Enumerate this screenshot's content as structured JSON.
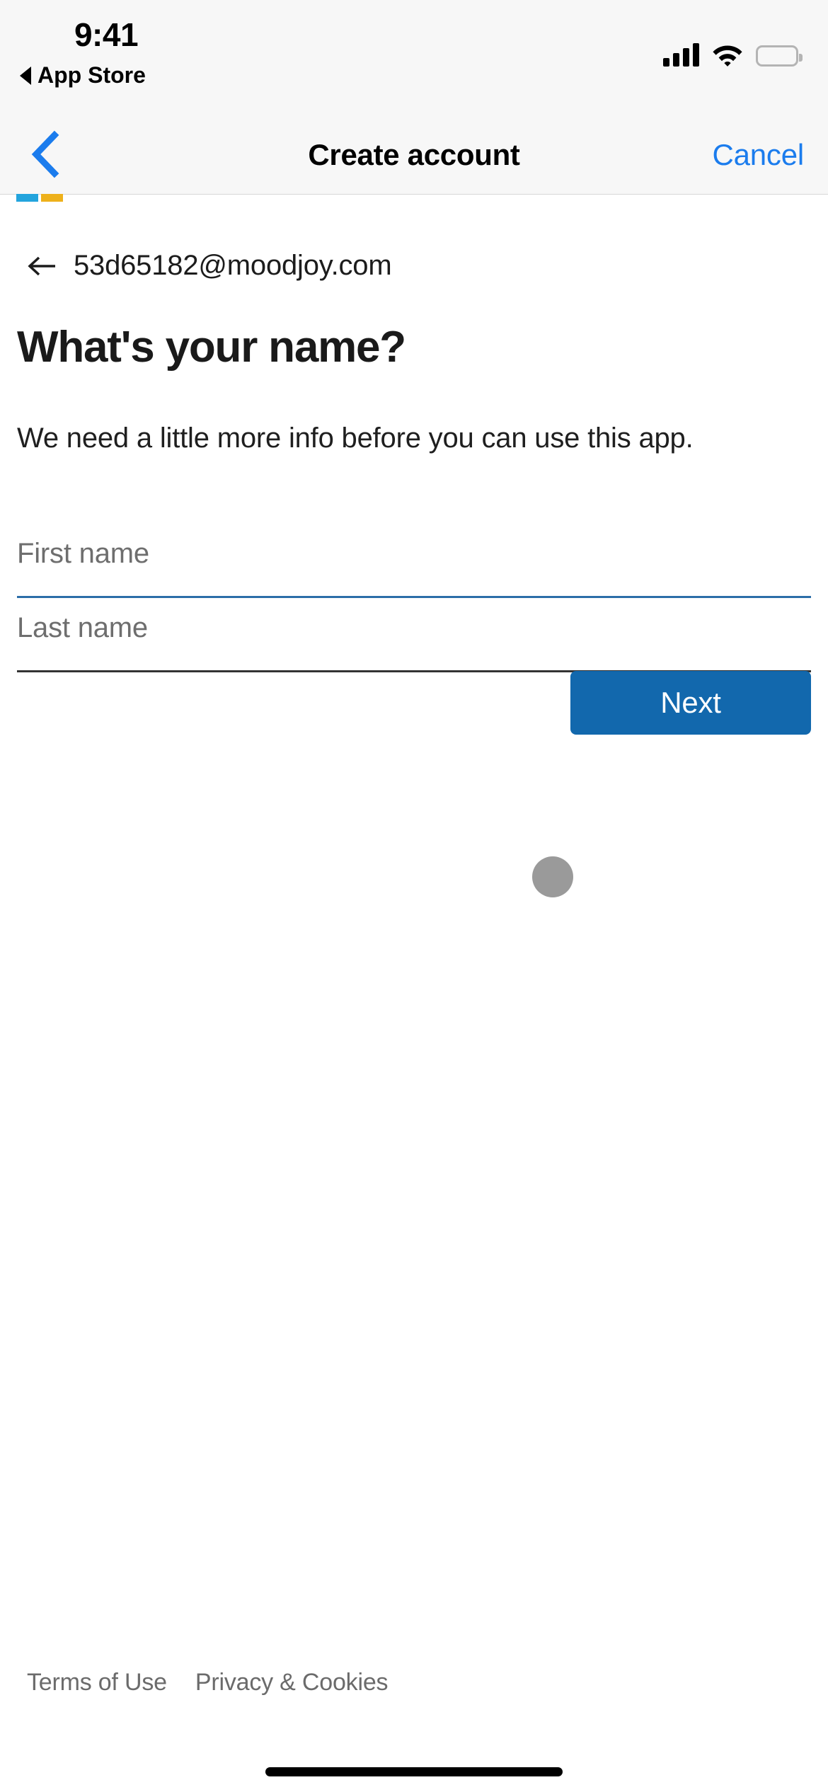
{
  "status_bar": {
    "time": "9:41",
    "back_app_label": "App Store",
    "signal_bars_filled": 4,
    "wifi": "wifi-icon",
    "battery_full": true
  },
  "nav_bar": {
    "back_icon": "chevron-left-icon",
    "title": "Create account",
    "cancel_label": "Cancel"
  },
  "progress": {
    "segments": [
      {
        "name": "segment-1",
        "color": "#23a4dd"
      },
      {
        "name": "segment-2",
        "color": "#eeb11b"
      }
    ]
  },
  "main": {
    "back_icon": "arrow-left-icon",
    "email": "53d65182@moodjoy.com",
    "headline": "What's your name?",
    "subtext": "We need a little more info before you can use this app.",
    "fields": [
      {
        "name": "first-name",
        "placeholder": "First name",
        "value": "",
        "focused": true,
        "underline_color": "#2b6ea8"
      },
      {
        "name": "last-name",
        "placeholder": "Last name",
        "value": "",
        "focused": false,
        "underline_color": "#333333"
      }
    ],
    "touch_indicator": {
      "name": "touch-point",
      "color": "#9a9a9a"
    },
    "next_label": "Next",
    "next_color": "#1268ad"
  },
  "footer": {
    "terms_label": "Terms of Use",
    "privacy_label": "Privacy & Cookies"
  }
}
